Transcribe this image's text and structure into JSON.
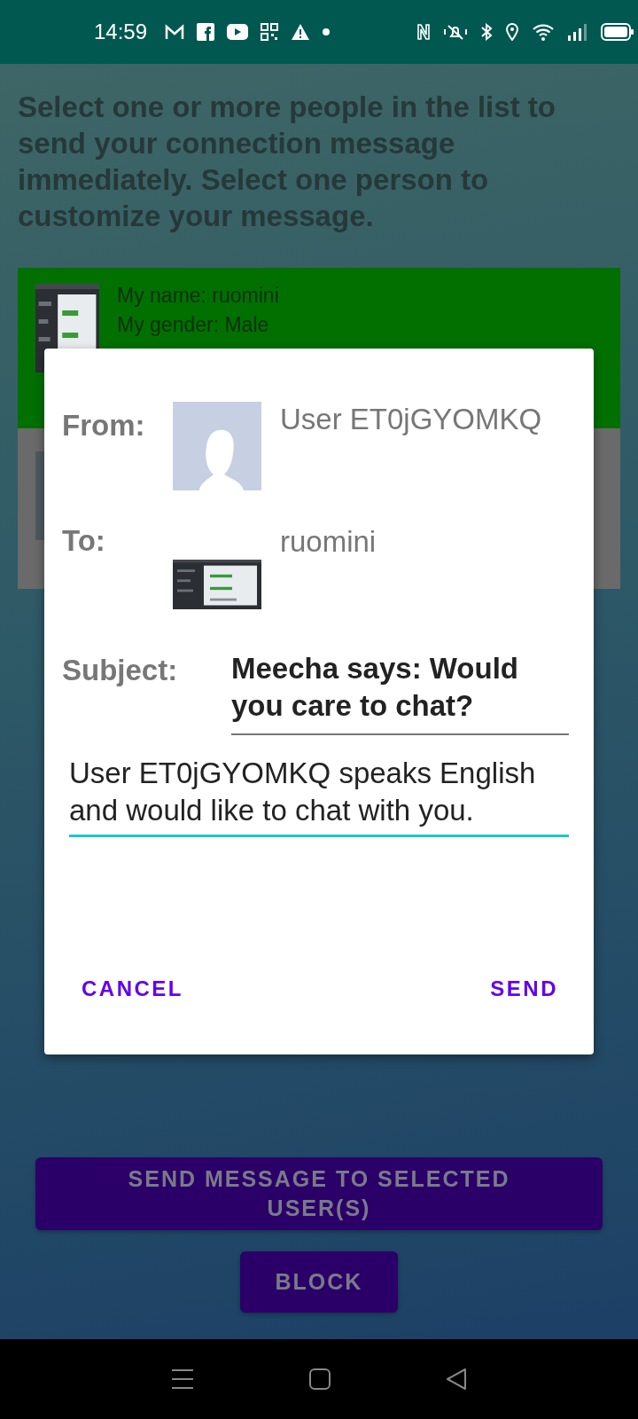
{
  "status_bar": {
    "time": "14:59"
  },
  "instructions": "Select one or more people in the list to send your connection message immediately. Select one person to customize your message.",
  "people": [
    {
      "selected": true,
      "lines": [
        "My name: ruomini",
        "My gender: Male"
      ]
    },
    {
      "selected": false
    }
  ],
  "dialog": {
    "from_label": "From:",
    "from_name": "User ET0jGYOMKQ",
    "to_label": "To:",
    "to_name": "ruomini",
    "subject_label": "Subject:",
    "subject": "Meecha says: Would you care to chat?",
    "message": "User ET0jGYOMKQ speaks English and would like to chat with you.",
    "buttons": [
      "CANCEL",
      "SEND"
    ]
  },
  "actions": [
    "SEND MESSAGE TO SELECTED USER(S)",
    "BLOCK"
  ]
}
